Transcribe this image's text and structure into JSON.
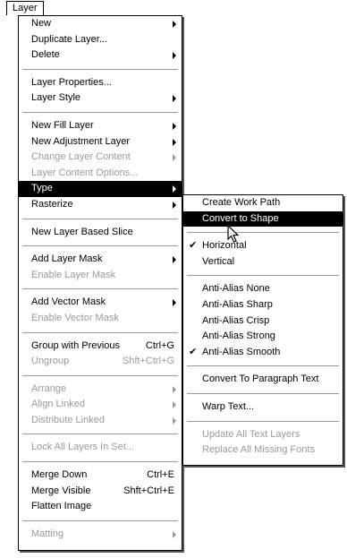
{
  "menubar": {
    "title": "Layer"
  },
  "main_menu": {
    "groups": [
      [
        {
          "label": "New",
          "submenu": true,
          "disabled": false
        },
        {
          "label": "Duplicate Layer...",
          "submenu": false,
          "disabled": false
        },
        {
          "label": "Delete",
          "submenu": true,
          "disabled": false
        }
      ],
      [
        {
          "label": "Layer Properties...",
          "submenu": false,
          "disabled": false
        },
        {
          "label": "Layer Style",
          "submenu": true,
          "disabled": false
        }
      ],
      [
        {
          "label": "New Fill Layer",
          "submenu": true,
          "disabled": false
        },
        {
          "label": "New Adjustment Layer",
          "submenu": true,
          "disabled": false
        },
        {
          "label": "Change Layer Content",
          "submenu": true,
          "disabled": true
        },
        {
          "label": "Layer Content Options...",
          "submenu": false,
          "disabled": true
        },
        {
          "label": "Type",
          "submenu": true,
          "disabled": false,
          "selected": true
        },
        {
          "label": "Rasterize",
          "submenu": true,
          "disabled": false
        }
      ],
      [
        {
          "label": "New Layer Based Slice",
          "submenu": false,
          "disabled": false
        }
      ],
      [
        {
          "label": "Add Layer Mask",
          "submenu": true,
          "disabled": false
        },
        {
          "label": "Enable Layer Mask",
          "submenu": false,
          "disabled": true
        }
      ],
      [
        {
          "label": "Add Vector Mask",
          "submenu": true,
          "disabled": false
        },
        {
          "label": "Enable Vector Mask",
          "submenu": false,
          "disabled": true
        }
      ],
      [
        {
          "label": "Group with Previous",
          "shortcut": "Ctrl+G",
          "submenu": false,
          "disabled": false
        },
        {
          "label": "Ungroup",
          "shortcut": "Shft+Ctrl+G",
          "submenu": false,
          "disabled": true
        }
      ],
      [
        {
          "label": "Arrange",
          "submenu": true,
          "disabled": true
        },
        {
          "label": "Align Linked",
          "submenu": true,
          "disabled": true
        },
        {
          "label": "Distribute Linked",
          "submenu": true,
          "disabled": true
        }
      ],
      [
        {
          "label": "Lock All Layers In Set...",
          "submenu": false,
          "disabled": true
        }
      ],
      [
        {
          "label": "Merge Down",
          "shortcut": "Ctrl+E",
          "submenu": false,
          "disabled": false
        },
        {
          "label": "Merge Visible",
          "shortcut": "Shft+Ctrl+E",
          "submenu": false,
          "disabled": false
        },
        {
          "label": "Flatten Image",
          "submenu": false,
          "disabled": false
        }
      ],
      [
        {
          "label": "Matting",
          "submenu": true,
          "disabled": true
        }
      ]
    ]
  },
  "type_menu": {
    "groups": [
      [
        {
          "label": "Create Work Path",
          "disabled": false
        },
        {
          "label": "Convert to Shape",
          "disabled": false,
          "selected": true
        }
      ],
      [
        {
          "label": "Horizontal",
          "disabled": false,
          "checked": true
        },
        {
          "label": "Vertical",
          "disabled": false
        }
      ],
      [
        {
          "label": "Anti-Alias None",
          "disabled": false
        },
        {
          "label": "Anti-Alias Sharp",
          "disabled": false
        },
        {
          "label": "Anti-Alias Crisp",
          "disabled": false
        },
        {
          "label": "Anti-Alias Strong",
          "disabled": false
        },
        {
          "label": "Anti-Alias Smooth",
          "disabled": false,
          "checked": true
        }
      ],
      [
        {
          "label": "Convert To Paragraph Text",
          "disabled": false
        }
      ],
      [
        {
          "label": "Warp Text...",
          "disabled": false
        }
      ],
      [
        {
          "label": "Update All Text Layers",
          "disabled": true
        },
        {
          "label": "Replace All Missing Fonts",
          "disabled": true
        }
      ]
    ]
  },
  "icons": {
    "submenu": "submenu-arrow-icon",
    "check": "checkmark-icon",
    "cursor": "mouse-pointer-icon"
  },
  "check_glyph": "✔"
}
